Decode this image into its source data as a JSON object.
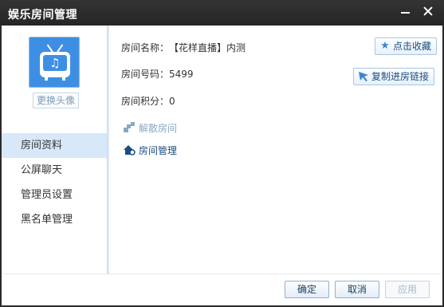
{
  "window": {
    "title": "娱乐房间管理"
  },
  "sidebar": {
    "change_avatar_label": "更换头像",
    "items": [
      {
        "label": "房间资料",
        "active": true
      },
      {
        "label": "公屏聊天",
        "active": false
      },
      {
        "label": "管理员设置",
        "active": false
      },
      {
        "label": "黑名单管理",
        "active": false
      }
    ]
  },
  "room": {
    "name_label": "房间名称：",
    "name_value": "【花样直播】内测",
    "number_label": "房间号码：",
    "number_value": "5499",
    "points_label": "房间积分：",
    "points_value": "0"
  },
  "actions": {
    "favorite_label": "点击收藏",
    "copy_link_label": "复制进房链接",
    "dissolve_label": "解散房间",
    "manage_label": "房间管理"
  },
  "footer": {
    "ok_label": "确定",
    "cancel_label": "取消",
    "apply_label": "应用"
  },
  "icons": {
    "favorite": "star-icon",
    "copy_link": "pointer-icon",
    "dissolve": "dissolve-room-icon",
    "manage": "room-settings-icon",
    "avatar": "tv-music-icon"
  },
  "colors": {
    "accent": "#3e8fe4",
    "titlebar": "#2b2b2b",
    "nav_active": "#d7e8f9"
  }
}
